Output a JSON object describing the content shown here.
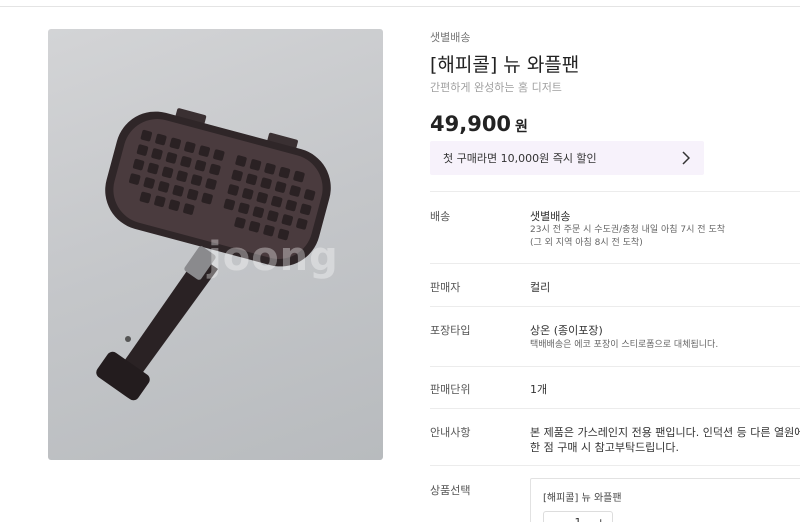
{
  "product": {
    "delivery_tag": "샛별배송",
    "title": "[해피콜] 뉴 와플팬",
    "subtitle": "간편하게 완성하는 홈 디저트",
    "price": "49,900",
    "price_unit": "원",
    "coupon_text": "첫 구매라면 10,000원 즉시 할인",
    "image_watermark": "joong"
  },
  "details": {
    "delivery": {
      "label": "배송",
      "value": "샛별배송",
      "sub1": "23시 전 주문 시 수도권/충청 내일 아침 7시 전 도착",
      "sub2": "(그 외 지역 아침 8시 전 도착)"
    },
    "seller": {
      "label": "판매자",
      "value": "컬리"
    },
    "packaging": {
      "label": "포장타입",
      "value": "상온 (종이포장)",
      "sub1": "택배배송은 에코 포장이 스티로폼으로 대체됩니다."
    },
    "unit": {
      "label": "판매단위",
      "value": "1개"
    },
    "notice": {
      "label": "안내사항",
      "value": "본 제품은 가스레인지 전용 팬입니다. 인덕션 등 다른 열원에서는",
      "value2": "한 점 구매 시 참고부탁드립니다."
    },
    "option": {
      "label": "상품선택",
      "name": "[해피콜] 뉴 와플팬",
      "minus": "−",
      "qty": "1",
      "plus": "+"
    }
  }
}
